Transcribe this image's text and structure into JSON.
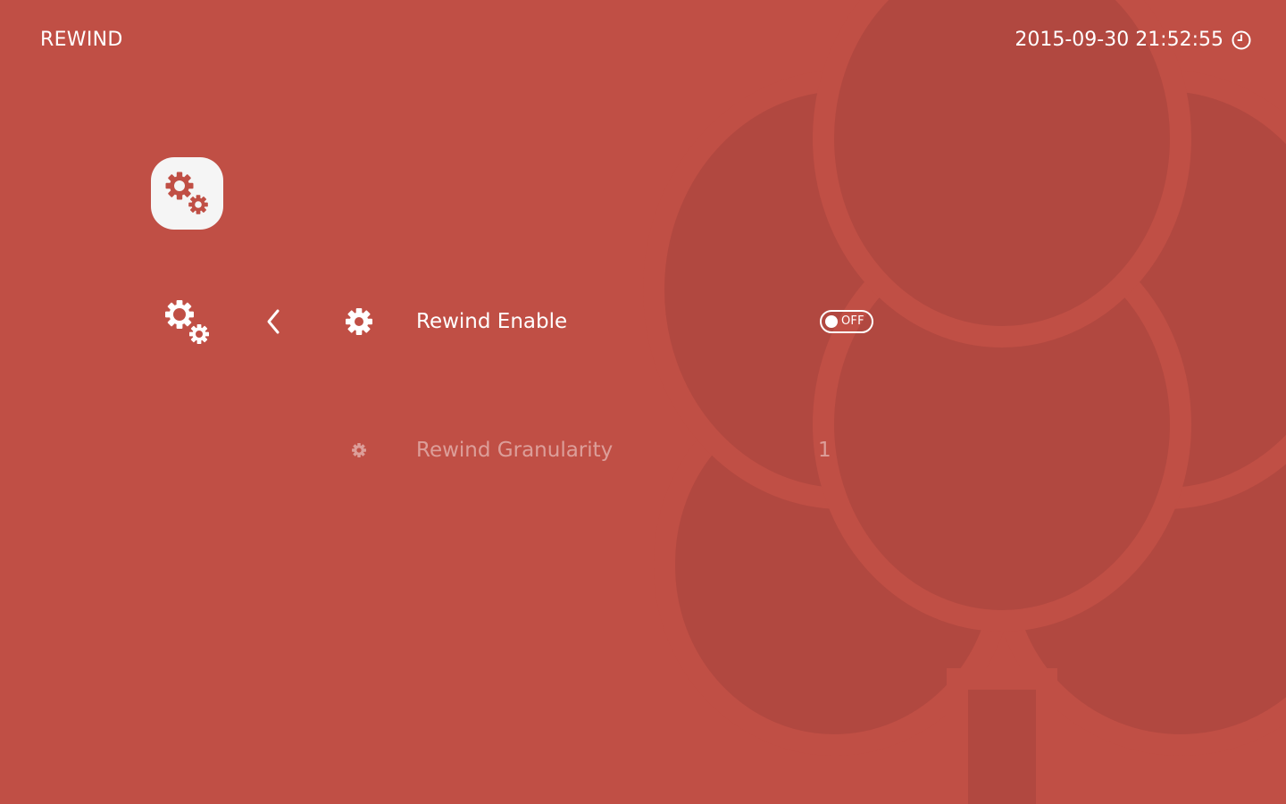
{
  "header": {
    "title": "REWIND",
    "datetime": "2015-09-30 21:52:55",
    "clock_icon": "clock-icon"
  },
  "sidebar": {
    "category_icon": "gears-icon",
    "back_icon": "chevron-left-icon"
  },
  "menu": {
    "items": [
      {
        "label": "Rewind Enable",
        "icon": "gear-icon",
        "control": "toggle",
        "value": "OFF",
        "selected": true
      },
      {
        "label": "Rewind Granularity",
        "icon": "gear-icon",
        "control": "value",
        "value": "1",
        "selected": false
      }
    ]
  },
  "colors": {
    "background": "#c04f45",
    "background_art": "#b14840",
    "foreground": "#ffffff",
    "tile": "#f5f5f5"
  }
}
